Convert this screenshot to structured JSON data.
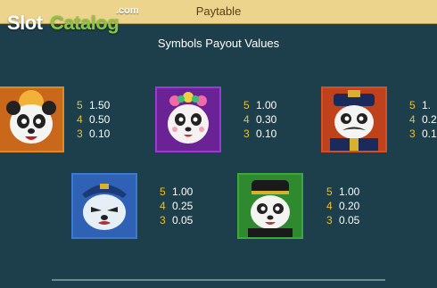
{
  "header": {
    "title": "Paytable"
  },
  "watermark": {
    "brand_a": "Slot",
    "brand_b": "Catalog",
    "suffix": ".com"
  },
  "section": {
    "title": "Symbols Payout Values"
  },
  "symbols": [
    {
      "icon": "panda-orange-icon",
      "frame_color": "#e08a1c",
      "payouts": [
        {
          "count": "5",
          "value": "1.50"
        },
        {
          "count": "4",
          "value": "0.50"
        },
        {
          "count": "3",
          "value": "0.10"
        }
      ]
    },
    {
      "icon": "panda-purple-flower-icon",
      "frame_color": "#9a3ad0",
      "payouts": [
        {
          "count": "5",
          "value": "1.00"
        },
        {
          "count": "4",
          "value": "0.30"
        },
        {
          "count": "3",
          "value": "0.10"
        }
      ]
    },
    {
      "icon": "panda-red-official-icon",
      "frame_color": "#d0502a",
      "payouts": [
        {
          "count": "5",
          "value": "1."
        },
        {
          "count": "4",
          "value": "0.2"
        },
        {
          "count": "3",
          "value": "0.1"
        }
      ]
    },
    {
      "icon": "panda-blue-hat-icon",
      "frame_color": "#3a7ad0",
      "payouts": [
        {
          "count": "5",
          "value": "1.00"
        },
        {
          "count": "4",
          "value": "0.25"
        },
        {
          "count": "3",
          "value": "0.05"
        }
      ]
    },
    {
      "icon": "panda-green-hat-icon",
      "frame_color": "#3aa83a",
      "payouts": [
        {
          "count": "5",
          "value": "1.00"
        },
        {
          "count": "4",
          "value": "0.20"
        },
        {
          "count": "3",
          "value": "0.05"
        }
      ]
    }
  ]
}
